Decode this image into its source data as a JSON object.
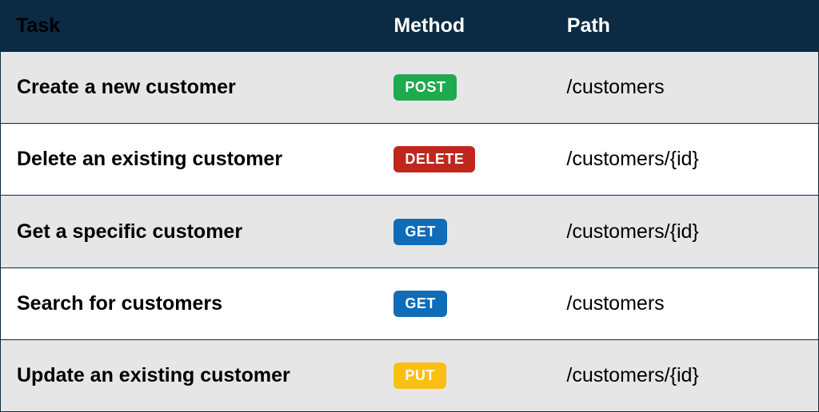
{
  "headers": {
    "task": "Task",
    "method": "Method",
    "path": "Path"
  },
  "method_colors": {
    "POST": "#1eaa4e",
    "DELETE": "#c1261c",
    "GET": "#0e6cb8",
    "PUT": "#f9c013"
  },
  "rows": [
    {
      "task": "Create a new customer",
      "method": "POST",
      "path": "/customers"
    },
    {
      "task": "Delete an existing customer",
      "method": "DELETE",
      "path": "/customers/{id}"
    },
    {
      "task": "Get a specific customer",
      "method": "GET",
      "path": "/customers/{id}"
    },
    {
      "task": "Search for customers",
      "method": "GET",
      "path": "/customers"
    },
    {
      "task": "Update an existing customer",
      "method": "PUT",
      "path": "/customers/{id}"
    }
  ]
}
